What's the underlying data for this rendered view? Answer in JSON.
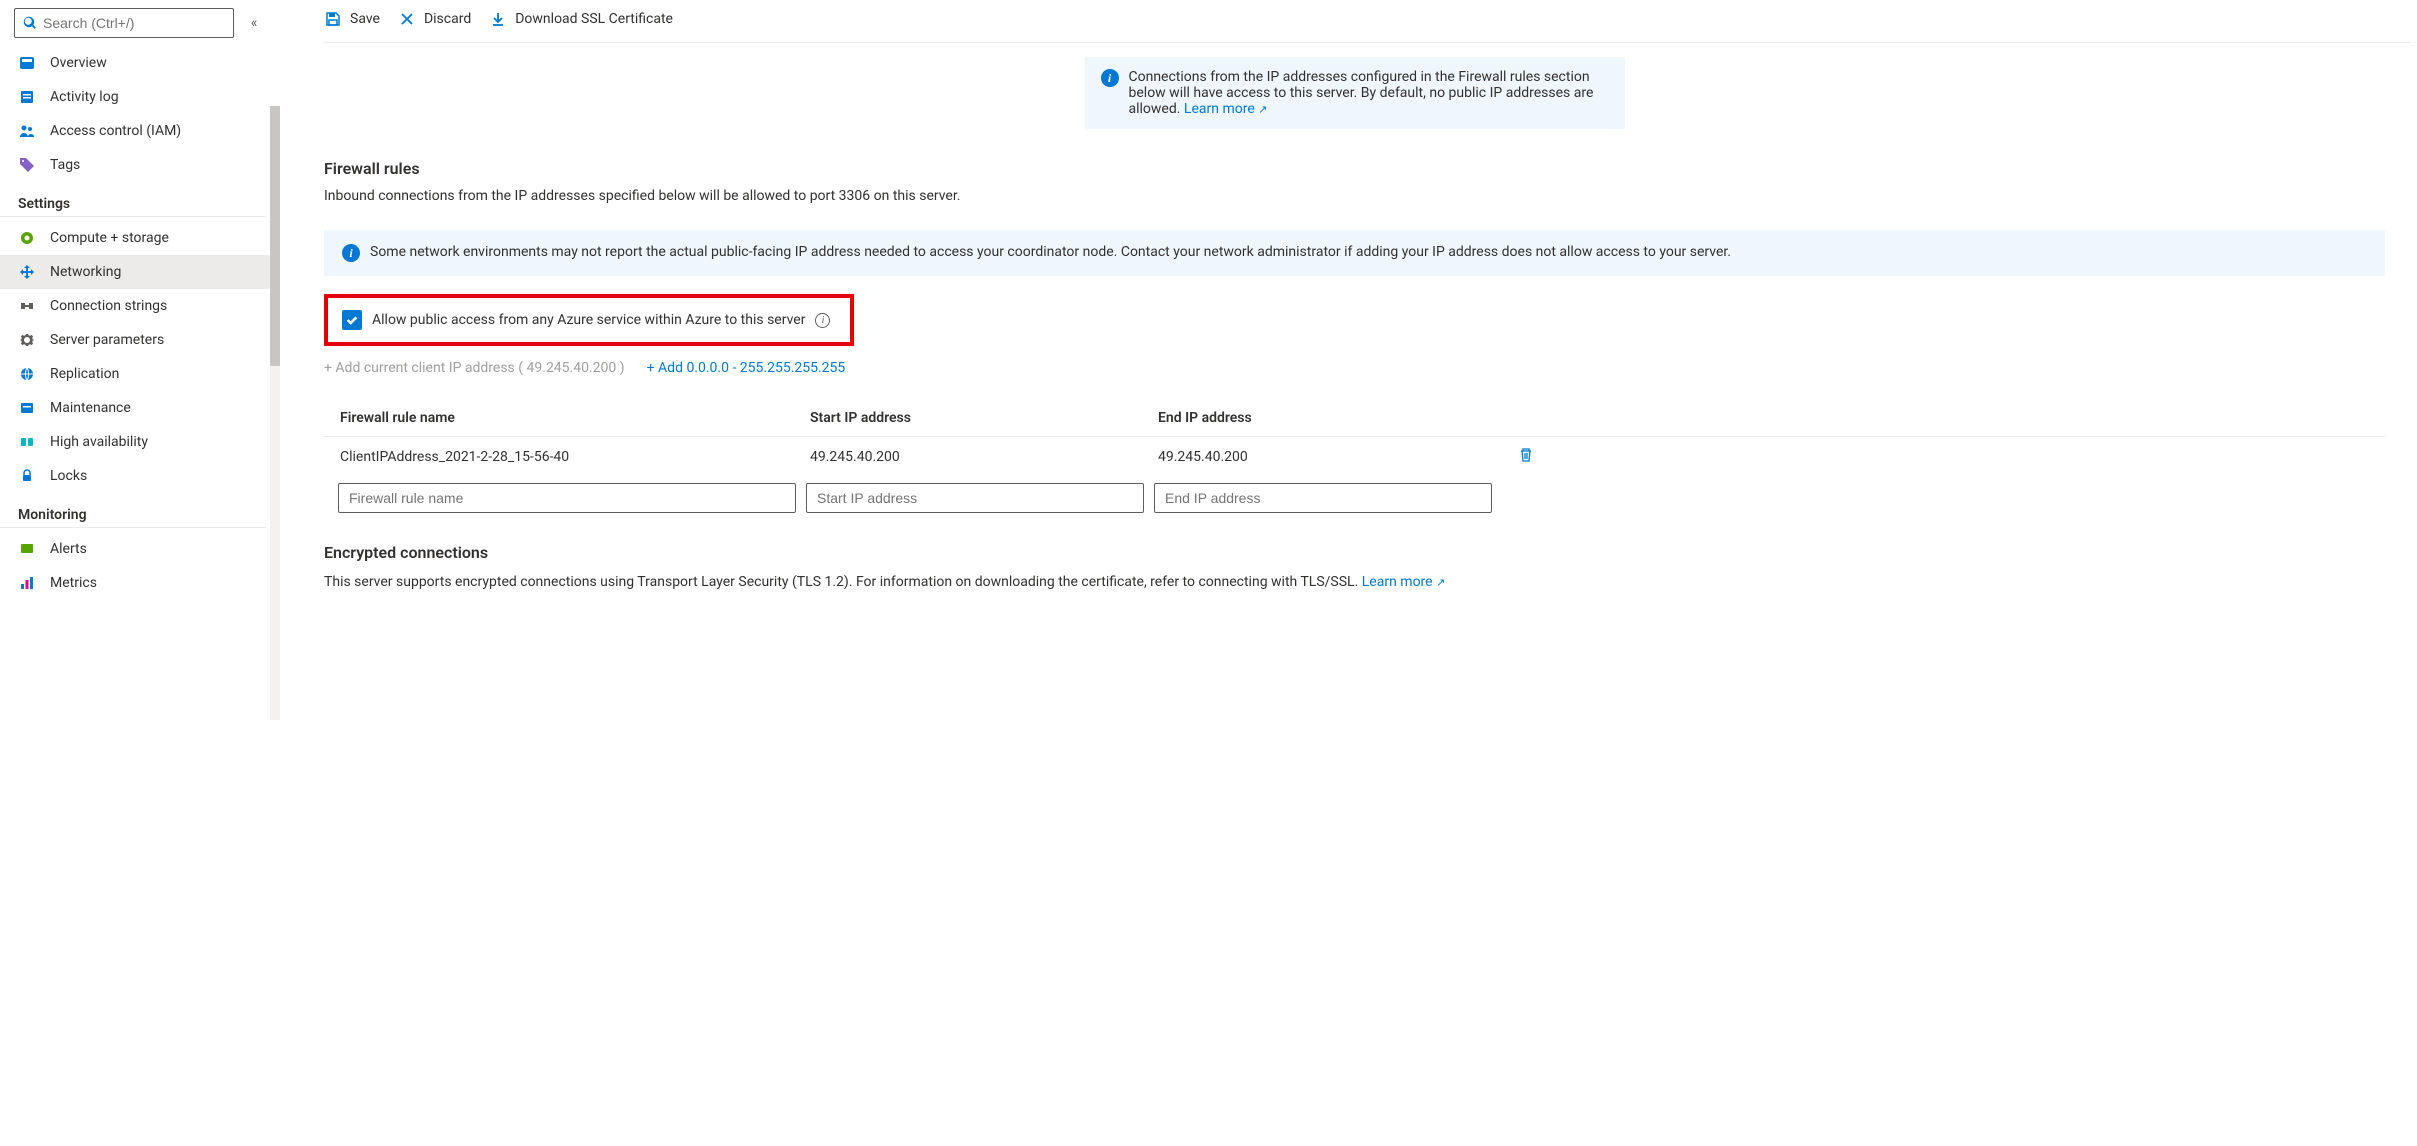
{
  "sidebar": {
    "search_placeholder": "Search (Ctrl+/)",
    "top": [
      {
        "label": "Overview"
      },
      {
        "label": "Activity log"
      },
      {
        "label": "Access control (IAM)"
      },
      {
        "label": "Tags"
      }
    ],
    "settings_header": "Settings",
    "settings": [
      {
        "label": "Compute + storage"
      },
      {
        "label": "Networking"
      },
      {
        "label": "Connection strings"
      },
      {
        "label": "Server parameters"
      },
      {
        "label": "Replication"
      },
      {
        "label": "Maintenance"
      },
      {
        "label": "High availability"
      },
      {
        "label": "Locks"
      }
    ],
    "monitoring_header": "Monitoring",
    "monitoring": [
      {
        "label": "Alerts"
      },
      {
        "label": "Metrics"
      }
    ]
  },
  "toolbar": {
    "save": "Save",
    "discard": "Discard",
    "download": "Download SSL Certificate"
  },
  "banner1": {
    "text": "Connections from the IP addresses configured in the Firewall rules section below will have access to this server. By default, no public IP addresses are allowed. ",
    "link": "Learn more"
  },
  "firewall": {
    "title": "Firewall rules",
    "subtitle": "Inbound connections from the IP addresses specified below will be allowed to port 3306 on this server."
  },
  "banner2": {
    "text": "Some network environments may not report the actual public-facing IP address needed to access your coordinator node. Contact your network administrator if adding your IP address does not allow access to your server."
  },
  "allow_azure": {
    "label": "Allow public access from any Azure service within Azure to this server"
  },
  "add": {
    "current": "+ Add current client IP address ( 49.245.40.200 )",
    "any": "+ Add 0.0.0.0 - 255.255.255.255"
  },
  "table": {
    "col_name": "Firewall rule name",
    "col_start": "Start IP address",
    "col_end": "End IP address",
    "rows": [
      {
        "name": "ClientIPAddress_2021-2-28_15-56-40",
        "start": "49.245.40.200",
        "end": "49.245.40.200"
      }
    ],
    "ph_name": "Firewall rule name",
    "ph_start": "Start IP address",
    "ph_end": "End IP address"
  },
  "encrypted": {
    "title": "Encrypted connections",
    "text": "This server supports encrypted connections using Transport Layer Security (TLS 1.2). For information on downloading the certificate, refer to connecting with TLS/SSL. ",
    "link": "Learn more"
  }
}
